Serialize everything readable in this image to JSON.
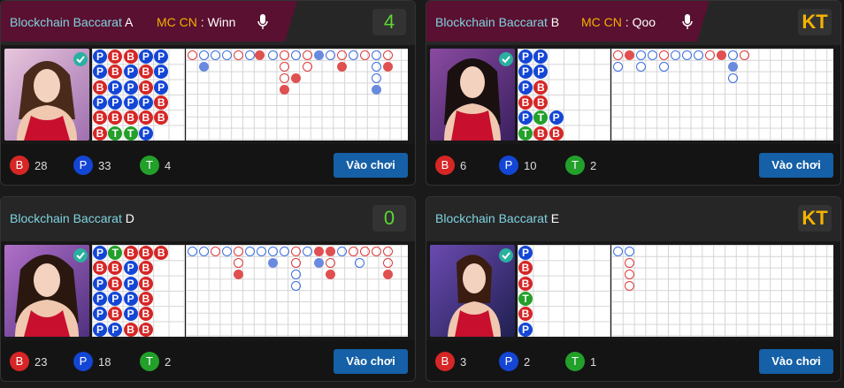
{
  "tables": [
    {
      "id": "A",
      "title": "Blockchain Baccarat ",
      "letter": "A",
      "mc_label": "MC CN",
      "mc_name": "Winn",
      "badge": "4",
      "badge_type": "num",
      "stats": {
        "B": "28",
        "P": "33",
        "T": "4"
      },
      "play": "Vào chơi",
      "bead": [
        [
          "P",
          "B",
          "B",
          "P",
          "P"
        ],
        [
          "P",
          "B",
          "P",
          "B",
          "P"
        ],
        [
          "B",
          "P",
          "P",
          "B",
          "P"
        ],
        [
          "P",
          "P",
          "P",
          "P",
          "B"
        ],
        [
          "B",
          "B",
          "B",
          "B",
          "B"
        ],
        [
          "B",
          "T",
          "T",
          "P",
          ""
        ]
      ],
      "dress": "#c8102e",
      "bg": "#cfa0c0"
    },
    {
      "id": "B",
      "title": "Blockchain Baccarat ",
      "letter": "B",
      "mc_label": "MC CN",
      "mc_name": "Qoo",
      "badge": "KT",
      "badge_type": "kt",
      "stats": {
        "B": "6",
        "P": "10",
        "T": "2"
      },
      "play": "Vào chơi",
      "bead": [
        [
          "P",
          "P",
          ""
        ],
        [
          "P",
          "P",
          ""
        ],
        [
          "P",
          "B",
          ""
        ],
        [
          "B",
          "B",
          ""
        ],
        [
          "P",
          "T",
          "P"
        ],
        [
          "T",
          "B",
          "B"
        ]
      ],
      "dress": "#c8102e",
      "bg": "#7a3c8a"
    },
    {
      "id": "D",
      "title": "Blockchain Baccarat ",
      "letter": "D",
      "mc_label": "",
      "mc_name": "",
      "badge": "0",
      "badge_type": "num",
      "stats": {
        "B": "23",
        "P": "18",
        "T": "2"
      },
      "play": "Vào chơi",
      "bead": [
        [
          "P",
          "T",
          "B",
          "B",
          "B"
        ],
        [
          "B",
          "B",
          "P",
          "B",
          ""
        ],
        [
          "P",
          "B",
          "P",
          "B",
          ""
        ],
        [
          "P",
          "P",
          "P",
          "B",
          ""
        ],
        [
          "P",
          "B",
          "P",
          "B",
          ""
        ],
        [
          "P",
          "P",
          "B",
          "B",
          ""
        ]
      ],
      "dress": "#c8102e",
      "bg": "#8a5aa8"
    },
    {
      "id": "E",
      "title": "Blockchain Baccarat ",
      "letter": "E",
      "mc_label": "",
      "mc_name": "",
      "badge": "KT",
      "badge_type": "kt",
      "stats": {
        "B": "3",
        "P": "2",
        "T": "1"
      },
      "play": "Vào chơi",
      "bead": [
        [
          "P"
        ],
        [
          "B"
        ],
        [
          "B"
        ],
        [
          "T"
        ],
        [
          "B"
        ],
        [
          "P"
        ]
      ],
      "dress": "#c8102e",
      "bg": "#4a3c8a"
    }
  ]
}
